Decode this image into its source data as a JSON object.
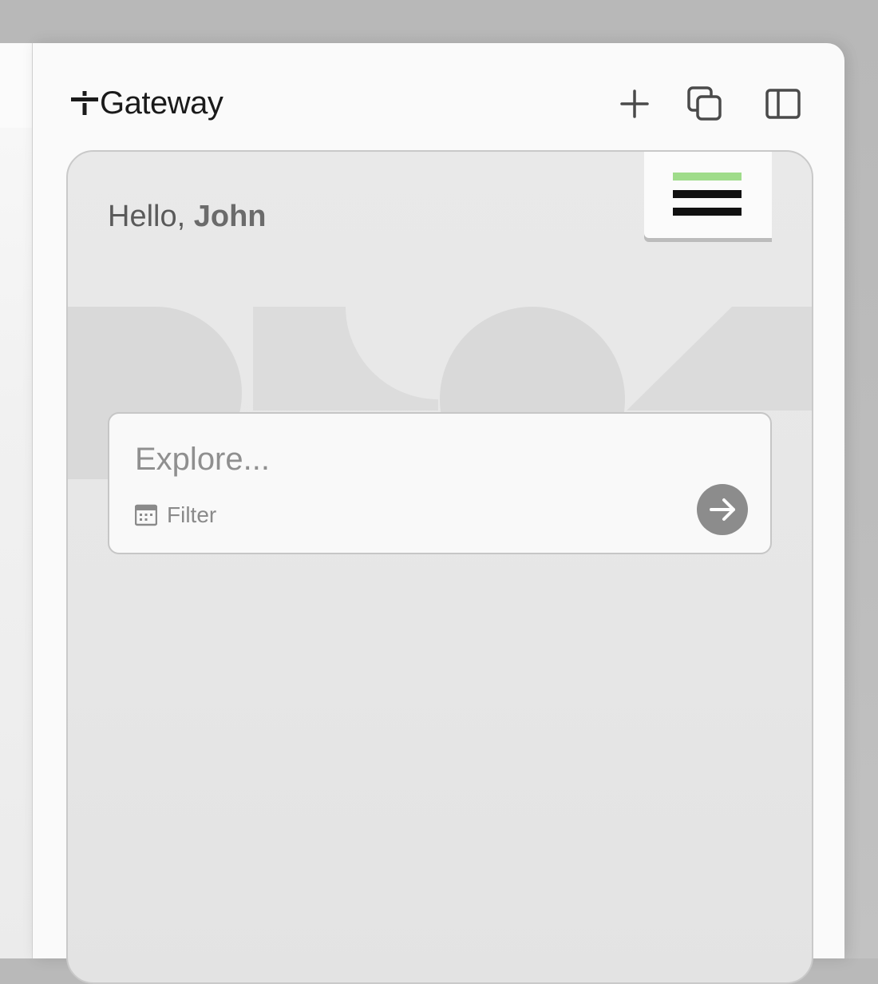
{
  "app": {
    "brand_name": "Gateway",
    "brand_mark_icon": "plus-minus-logo-icon"
  },
  "header": {
    "actions": [
      {
        "id": "new",
        "icon": "plus-icon"
      },
      {
        "id": "copy",
        "icon": "copy-windows-icon"
      },
      {
        "id": "sidebar",
        "icon": "sidebar-toggle-icon"
      }
    ]
  },
  "greeting": {
    "prefix": "Hello,",
    "name": "John"
  },
  "menu": {
    "icon": "hamburger-menu-icon",
    "colors": {
      "top_bar": "#9fdc8a",
      "bars": "#111111"
    }
  },
  "search": {
    "placeholder": "Explore...",
    "value": "",
    "filter_label": "Filter",
    "filter_icon": "calendar-icon",
    "submit_icon": "arrow-right-icon"
  },
  "colors": {
    "window_bg": "#fafafa",
    "card_bg": "#e7e7e7",
    "accent_green": "#9fdc8a",
    "submit_bg": "#8c8c8c"
  }
}
